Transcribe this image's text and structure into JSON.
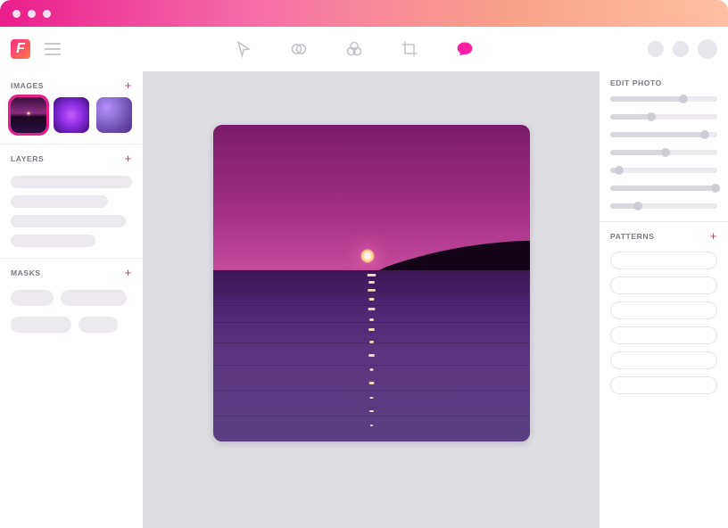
{
  "sections": {
    "images_label": "IMAGES",
    "layers_label": "LAYERS",
    "masks_label": "MASKS",
    "edit_label": "EDIT PHOTO",
    "patterns_label": "PATTERNS"
  },
  "toolbar": {
    "tools": [
      "pointer",
      "combine",
      "filters",
      "crop",
      "comment"
    ],
    "active_tool": "comment"
  },
  "images": {
    "selected_index": 0,
    "count": 3
  },
  "layers": {
    "placeholders": [
      100,
      80,
      95,
      70
    ]
  },
  "masks": {
    "row1": [
      35,
      65
    ],
    "row2": [
      55,
      40
    ]
  },
  "sliders": [
    68,
    38,
    88,
    52,
    8,
    98,
    26
  ],
  "patterns_count": 6,
  "colors": {
    "accent": "#e91e8c",
    "comment_active": "#ff1fa5"
  }
}
